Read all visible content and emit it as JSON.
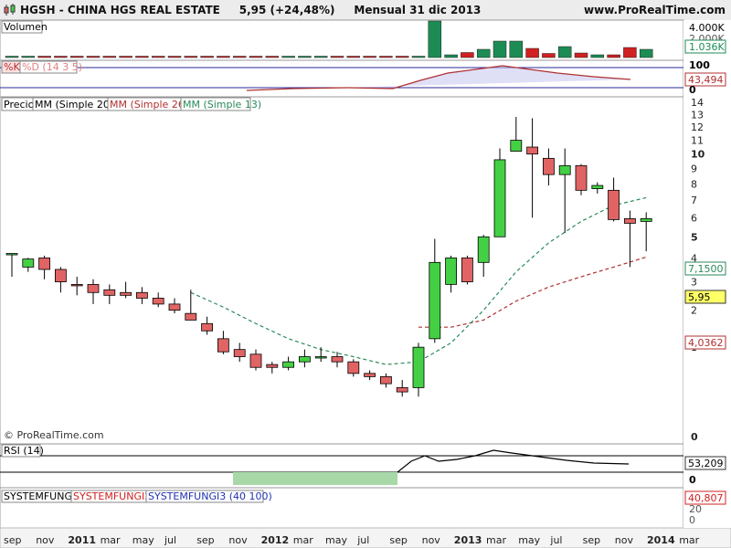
{
  "header": {
    "ticker": "HGSH - CHINA HGS REAL ESTATE",
    "price": "5,95 (+24,48%)",
    "period": "Mensual  31 dic 2013",
    "site": "www.ProRealTime.com"
  },
  "watermark": "© ProRealTime.com",
  "colors": {
    "up": "#44d044",
    "down": "#e06464",
    "volume_up": "#1c8c54",
    "volume_down": "#d02020",
    "mm26": "#b03030",
    "mm13": "#2a8a5a",
    "rsi": "#000000",
    "stoch_k": "#7070d0",
    "stoch_d": "#b03030"
  },
  "panels": {
    "volume": {
      "label": "Volumen",
      "tags": [
        "4.000K",
        "2.000K",
        "1.036K"
      ]
    },
    "stoch": {
      "labels": [
        "%K",
        "%D (14 3 5)"
      ],
      "axis": [
        "100",
        "0"
      ],
      "value": "43,494"
    },
    "price": {
      "labels": [
        "Precio",
        "MM (Simple 200)",
        "MM (Simple 26)",
        "MM (Simple 13)"
      ],
      "mm13_value": "7,1500",
      "last_value": "5,95",
      "mm26_value": "4,0362"
    },
    "rsi": {
      "label": "RSI (14)",
      "value": "53,209",
      "axis": [
        "0"
      ]
    },
    "system": {
      "labels": [
        "SYSTEMFUNGI",
        "SYSTEMFUNGI2",
        "SYSTEMFUNGI3 (40 100)"
      ],
      "value": "40,807",
      "axis": [
        "20",
        "0"
      ]
    }
  },
  "chart_data": {
    "type": "candlestick",
    "title": "HGSH - CHINA HGS REAL ESTATE",
    "interval": "Mensual",
    "y_axis_ticks": [
      0,
      1,
      2,
      3,
      4,
      5,
      6,
      7,
      8,
      9,
      10,
      11,
      12,
      13,
      14
    ],
    "y_axis_scale": "log",
    "x_axis_labels": [
      "sep",
      "nov",
      "2011",
      "mar",
      "may",
      "jul",
      "sep",
      "nov",
      "2012",
      "mar",
      "may",
      "jul",
      "sep",
      "nov",
      "2013",
      "mar",
      "may",
      "jul",
      "sep",
      "nov",
      "2014",
      "mar"
    ],
    "candles": [
      {
        "x": "2010-09",
        "o": 4.2,
        "h": 4.2,
        "l": 3.2,
        "c": 4.2
      },
      {
        "x": "2010-10",
        "o": 3.6,
        "h": 4.0,
        "l": 3.4,
        "c": 3.95
      },
      {
        "x": "2010-11",
        "o": 4.0,
        "h": 4.1,
        "l": 3.1,
        "c": 3.5
      },
      {
        "x": "2010-12",
        "o": 3.5,
        "h": 3.6,
        "l": 2.6,
        "c": 3.0
      },
      {
        "x": "2011-01",
        "o": 2.9,
        "h": 3.2,
        "l": 2.5,
        "c": 2.85
      },
      {
        "x": "2011-02",
        "o": 2.9,
        "h": 3.1,
        "l": 2.2,
        "c": 2.6
      },
      {
        "x": "2011-03",
        "o": 2.7,
        "h": 2.9,
        "l": 2.2,
        "c": 2.5
      },
      {
        "x": "2011-04",
        "o": 2.6,
        "h": 3.0,
        "l": 2.4,
        "c": 2.5
      },
      {
        "x": "2011-05",
        "o": 2.6,
        "h": 2.8,
        "l": 2.2,
        "c": 2.4
      },
      {
        "x": "2011-06",
        "o": 2.4,
        "h": 2.6,
        "l": 2.1,
        "c": 2.2
      },
      {
        "x": "2011-07",
        "o": 2.2,
        "h": 2.4,
        "l": 1.9,
        "c": 2.0
      },
      {
        "x": "2011-08",
        "o": 1.9,
        "h": 2.7,
        "l": 1.7,
        "c": 1.7
      },
      {
        "x": "2011-09",
        "o": 1.6,
        "h": 1.8,
        "l": 1.3,
        "c": 1.4
      },
      {
        "x": "2011-10",
        "o": 1.2,
        "h": 1.4,
        "l": 0.85,
        "c": 0.9
      },
      {
        "x": "2011-11",
        "o": 0.95,
        "h": 1.1,
        "l": 0.7,
        "c": 0.8
      },
      {
        "x": "2011-12",
        "o": 0.85,
        "h": 0.95,
        "l": 0.55,
        "c": 0.6
      },
      {
        "x": "2012-01",
        "o": 0.65,
        "h": 0.7,
        "l": 0.5,
        "c": 0.6
      },
      {
        "x": "2012-02",
        "o": 0.6,
        "h": 0.8,
        "l": 0.55,
        "c": 0.7
      },
      {
        "x": "2012-03",
        "o": 0.7,
        "h": 0.95,
        "l": 0.6,
        "c": 0.8
      },
      {
        "x": "2012-04",
        "o": 0.8,
        "h": 1.0,
        "l": 0.7,
        "c": 0.8
      },
      {
        "x": "2012-05",
        "o": 0.8,
        "h": 0.9,
        "l": 0.6,
        "c": 0.7
      },
      {
        "x": "2012-06",
        "o": 0.7,
        "h": 0.75,
        "l": 0.45,
        "c": 0.5
      },
      {
        "x": "2012-07",
        "o": 0.5,
        "h": 0.55,
        "l": 0.4,
        "c": 0.45
      },
      {
        "x": "2012-08",
        "o": 0.45,
        "h": 0.5,
        "l": 0.3,
        "c": 0.35
      },
      {
        "x": "2012-09",
        "o": 0.3,
        "h": 0.4,
        "l": 0.2,
        "c": 0.25
      },
      {
        "x": "2012-10",
        "o": 0.3,
        "h": 1.1,
        "l": 0.2,
        "c": 1.0
      },
      {
        "x": "2012-11",
        "o": 1.2,
        "h": 4.9,
        "l": 1.1,
        "c": 3.8
      },
      {
        "x": "2012-12",
        "o": 2.9,
        "h": 4.1,
        "l": 2.6,
        "c": 4.0
      },
      {
        "x": "2013-01",
        "o": 4.0,
        "h": 4.1,
        "l": 2.9,
        "c": 3.0
      },
      {
        "x": "2013-02",
        "o": 3.8,
        "h": 5.1,
        "l": 3.2,
        "c": 5.0
      },
      {
        "x": "2013-03",
        "o": 5.0,
        "h": 10.4,
        "l": 5.0,
        "c": 9.6
      },
      {
        "x": "2013-04",
        "o": 10.2,
        "h": 12.8,
        "l": 10.2,
        "c": 11.0
      },
      {
        "x": "2013-05",
        "o": 10.5,
        "h": 12.7,
        "l": 6.0,
        "c": 10.0
      },
      {
        "x": "2013-06",
        "o": 9.7,
        "h": 10.4,
        "l": 7.9,
        "c": 8.6
      },
      {
        "x": "2013-07",
        "o": 8.6,
        "h": 10.4,
        "l": 5.2,
        "c": 9.2
      },
      {
        "x": "2013-08",
        "o": 9.2,
        "h": 9.3,
        "l": 7.3,
        "c": 7.6
      },
      {
        "x": "2013-09",
        "o": 7.7,
        "h": 8.1,
        "l": 7.4,
        "c": 7.9
      },
      {
        "x": "2013-10",
        "o": 7.6,
        "h": 8.4,
        "l": 5.8,
        "c": 5.9
      },
      {
        "x": "2013-11",
        "o": 5.95,
        "h": 6.4,
        "l": 3.6,
        "c": 5.7
      },
      {
        "x": "2013-12",
        "o": 5.8,
        "h": 6.3,
        "l": 4.3,
        "c": 5.95
      }
    ],
    "series": [
      {
        "name": "MM (Simple 26)",
        "values": [
          {
            "x": "2012-10",
            "y": 1.5
          },
          {
            "x": "2012-12",
            "y": 1.5
          },
          {
            "x": "2013-02",
            "y": 1.7
          },
          {
            "x": "2013-04",
            "y": 2.3
          },
          {
            "x": "2013-06",
            "y": 2.8
          },
          {
            "x": "2013-08",
            "y": 3.2
          },
          {
            "x": "2013-10",
            "y": 3.6
          },
          {
            "x": "2013-12",
            "y": 4.0362
          }
        ]
      },
      {
        "name": "MM (Simple 13)",
        "values": [
          {
            "x": "2011-08",
            "y": 2.6
          },
          {
            "x": "2011-10",
            "y": 2.1
          },
          {
            "x": "2011-12",
            "y": 1.6
          },
          {
            "x": "2012-02",
            "y": 1.2
          },
          {
            "x": "2012-04",
            "y": 0.95
          },
          {
            "x": "2012-06",
            "y": 0.8
          },
          {
            "x": "2012-08",
            "y": 0.65
          },
          {
            "x": "2012-10",
            "y": 0.7
          },
          {
            "x": "2012-12",
            "y": 1.1
          },
          {
            "x": "2013-02",
            "y": 2.0
          },
          {
            "x": "2013-04",
            "y": 3.4
          },
          {
            "x": "2013-06",
            "y": 4.7
          },
          {
            "x": "2013-08",
            "y": 5.8
          },
          {
            "x": "2013-10",
            "y": 6.7
          },
          {
            "x": "2013-12",
            "y": 7.15
          }
        ]
      }
    ],
    "volume": [
      0.05,
      0.03,
      0.05,
      0.03,
      0.05,
      0.03,
      0.06,
      0.07,
      0.05,
      0.04,
      0.05,
      0.04,
      0.06,
      0.03,
      0.05,
      0.03,
      0.08,
      0.04,
      0.05,
      0.03,
      0.03,
      0.03,
      0.03,
      0.03,
      0.05,
      0.07,
      4.0,
      0.3,
      0.55,
      0.9,
      1.8,
      1.8,
      1.0,
      0.45,
      1.2,
      0.5,
      0.3,
      0.3,
      1.1,
      0.9
    ]
  }
}
